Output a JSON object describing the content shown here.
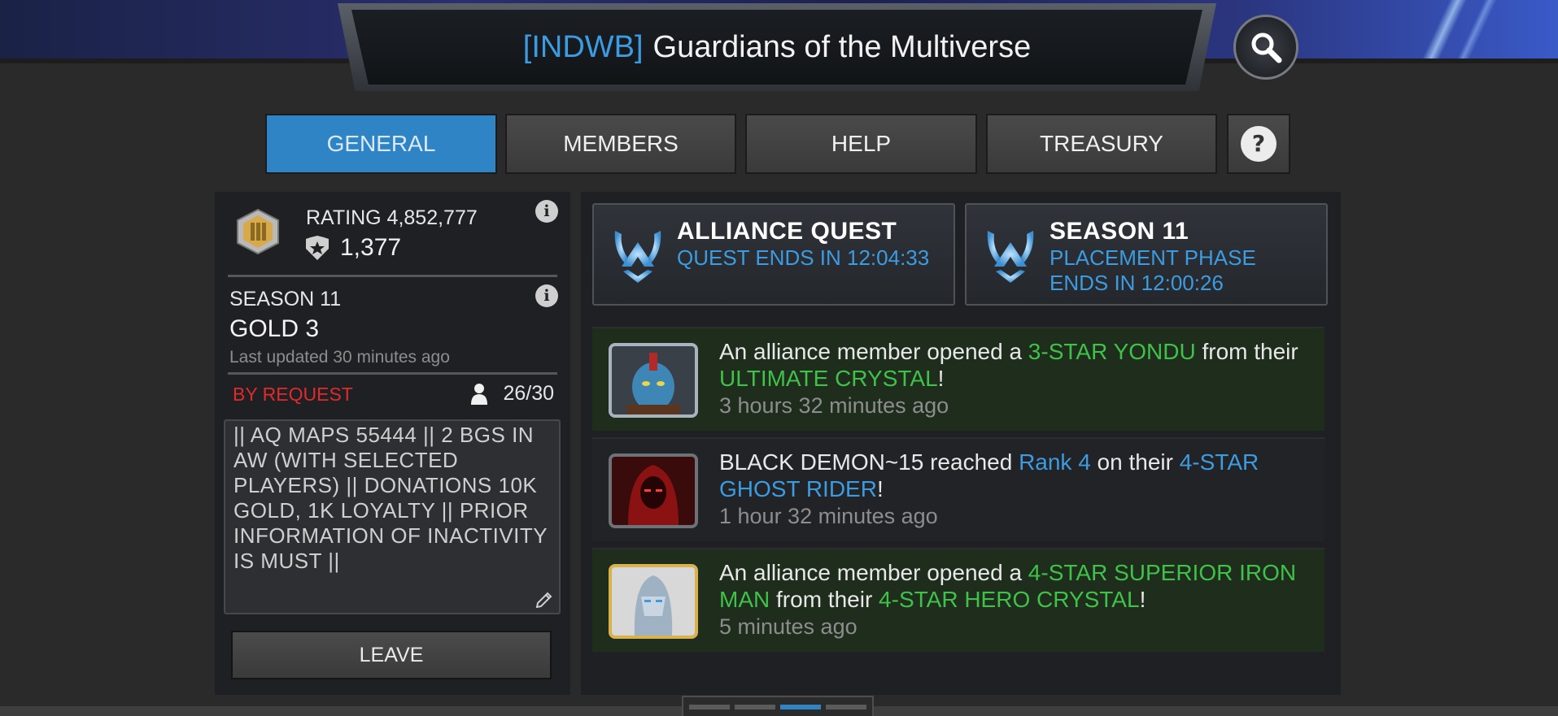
{
  "header": {
    "tag": "[INDWB]",
    "alliance_name": "Guardians of the Multiverse"
  },
  "tabs": [
    {
      "label": "GENERAL",
      "active": true
    },
    {
      "label": "MEMBERS",
      "active": false
    },
    {
      "label": "HELP",
      "active": false
    },
    {
      "label": "TREASURY",
      "active": false
    }
  ],
  "overview": {
    "rating_label": "RATING 4,852,777",
    "trophies": "1,377",
    "season_label": "SEASON 11",
    "season_tier": "GOLD 3",
    "last_updated": "Last updated 30 minutes ago",
    "join_policy": "BY REQUEST",
    "member_count": "26/30",
    "description": "|| AQ MAPS 55444 || 2 BGS IN AW (WITH SELECTED PLAYERS) || DONATIONS 10K GOLD, 1K LOYALTY || PRIOR INFORMATION OF INACTIVITY IS MUST ||",
    "leave_label": "LEAVE"
  },
  "event_cards": [
    {
      "title": "ALLIANCE QUEST",
      "subtitle": "QUEST ENDS IN 12:04:33"
    },
    {
      "title": "SEASON 11",
      "subtitle": "PLACEMENT PHASE ENDS IN 12:00:26"
    }
  ],
  "feed": [
    {
      "pre": "An alliance member opened a ",
      "hl1": "3-STAR YONDU",
      "mid": " from their ",
      "hl2": "ULTIMATE CRYSTAL",
      "post": "!",
      "time": "3 hours 32 minutes ago"
    },
    {
      "pre": "BLACK DEMON~15 reached ",
      "hl1": "Rank 4",
      "mid": " on their ",
      "hl2": "4-STAR GHOST RIDER",
      "post": "!",
      "time": "1 hour 32 minutes ago"
    },
    {
      "pre": "An alliance member opened a ",
      "hl1": "4-STAR SUPERIOR IRON MAN",
      "mid": " from their ",
      "hl2": "4-STAR HERO CRYSTAL",
      "post": "!",
      "time": "5 minutes ago"
    }
  ],
  "icons": [
    "search-icon",
    "question-icon",
    "info-icon",
    "trophy-icon",
    "user-icon",
    "pencil-icon",
    "alliance-wings-icon"
  ],
  "colors": {
    "accent_blue": "#3d9be0",
    "tab_active": "#2f84c6",
    "highlight_green": "#3fc14a",
    "policy_red": "#e12a2a"
  }
}
